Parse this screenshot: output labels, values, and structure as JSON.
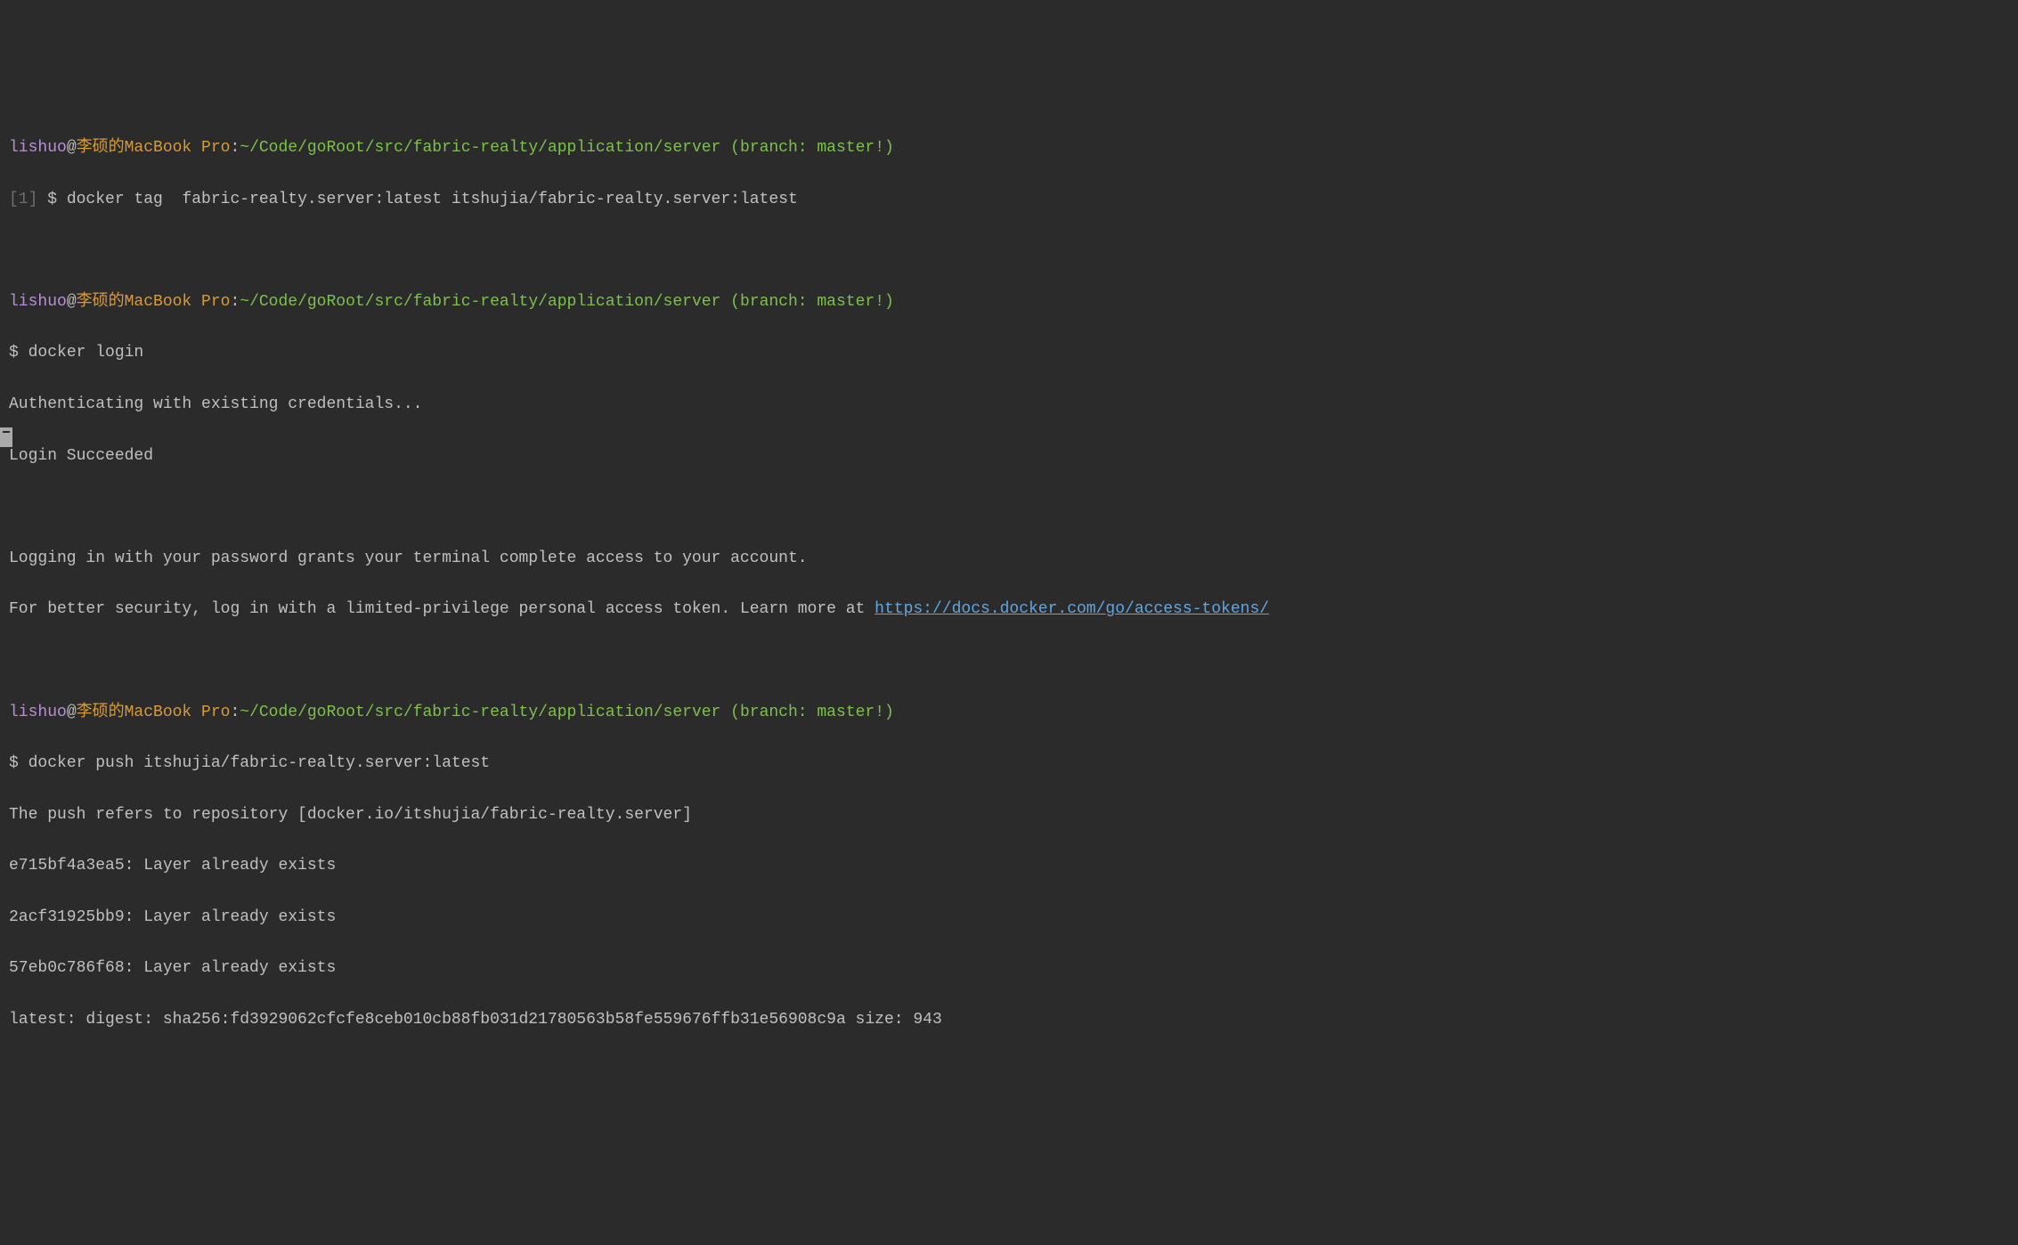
{
  "prompt": {
    "user": "lishuo",
    "at": "@",
    "host": "李硕的MacBook Pro",
    "colon": ":",
    "path": "~/Code/goRoot/src/fabric-realty/application/server",
    "branch": " (branch: master!)"
  },
  "block1": {
    "job": "[1] ",
    "ps": "$ ",
    "cmd": "docker tag  fabric-realty.server:latest itshujia/fabric-realty.server:latest"
  },
  "block2": {
    "ps": "$ ",
    "cmd": "docker login",
    "out1": "Authenticating with existing credentials...",
    "out2": "Login Succeeded",
    "out3": "Logging in with your password grants your terminal complete access to your account.",
    "out4a": "For better security, log in with a limited-privilege personal access token. Learn more at ",
    "out4link": "https://docs.docker.com/go/access-tokens/"
  },
  "block3": {
    "ps": "$ ",
    "cmd": "docker push itshujia/fabric-realty.server:latest",
    "out1": "The push refers to repository [docker.io/itshujia/fabric-realty.server]",
    "out2": "e715bf4a3ea5: Layer already exists",
    "out3": "2acf31925bb9: Layer already exists",
    "out4": "57eb0c786f68: Layer already exists",
    "out5": "latest: digest: sha256:fd3929062cfcfe8ceb010cb88fb031d21780563b58fe559676ffb31e56908c9a size: 943"
  },
  "blank": " "
}
